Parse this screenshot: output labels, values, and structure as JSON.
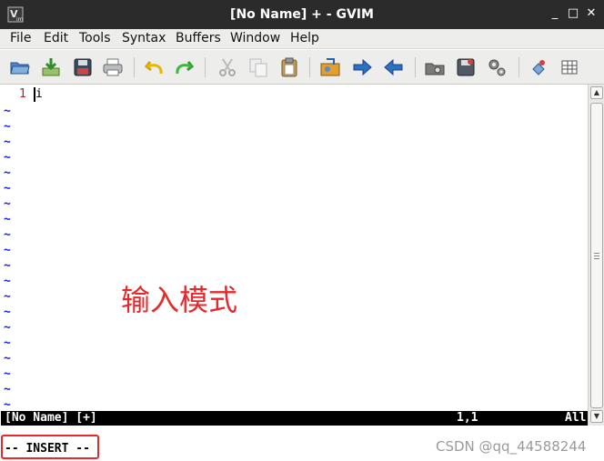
{
  "window": {
    "title": "[No Name] + - GVIM",
    "controls": {
      "minimize": "_",
      "maximize": "□",
      "close": "✕"
    }
  },
  "menubar": {
    "items": [
      "File",
      "Edit",
      "Tools",
      "Syntax",
      "Buffers",
      "Window",
      "Help"
    ]
  },
  "toolbar": {
    "icons": [
      "open-icon",
      "save-icon",
      "save-all-icon",
      "print-icon",
      "undo-icon",
      "redo-icon",
      "cut-icon",
      "copy-icon",
      "paste-icon",
      "replace-icon",
      "find-next-icon",
      "find-previous-icon",
      "load-session-icon",
      "save-session-icon",
      "run-script-icon",
      "make-icon",
      "ctags-icon"
    ]
  },
  "editor": {
    "line_number": "1",
    "cursor_char": "i",
    "tilde": "~",
    "tilde_color": "#1a1af0",
    "line_number_color": "#b22222"
  },
  "annotation": {
    "text": "输入模式",
    "color": "#e8282a"
  },
  "statusline": {
    "file": "[No Name] [+]",
    "position": "1,1",
    "scroll": "All"
  },
  "cmdline": {
    "mode": "-- INSERT --"
  },
  "watermark": "CSDN @qq_44588244"
}
